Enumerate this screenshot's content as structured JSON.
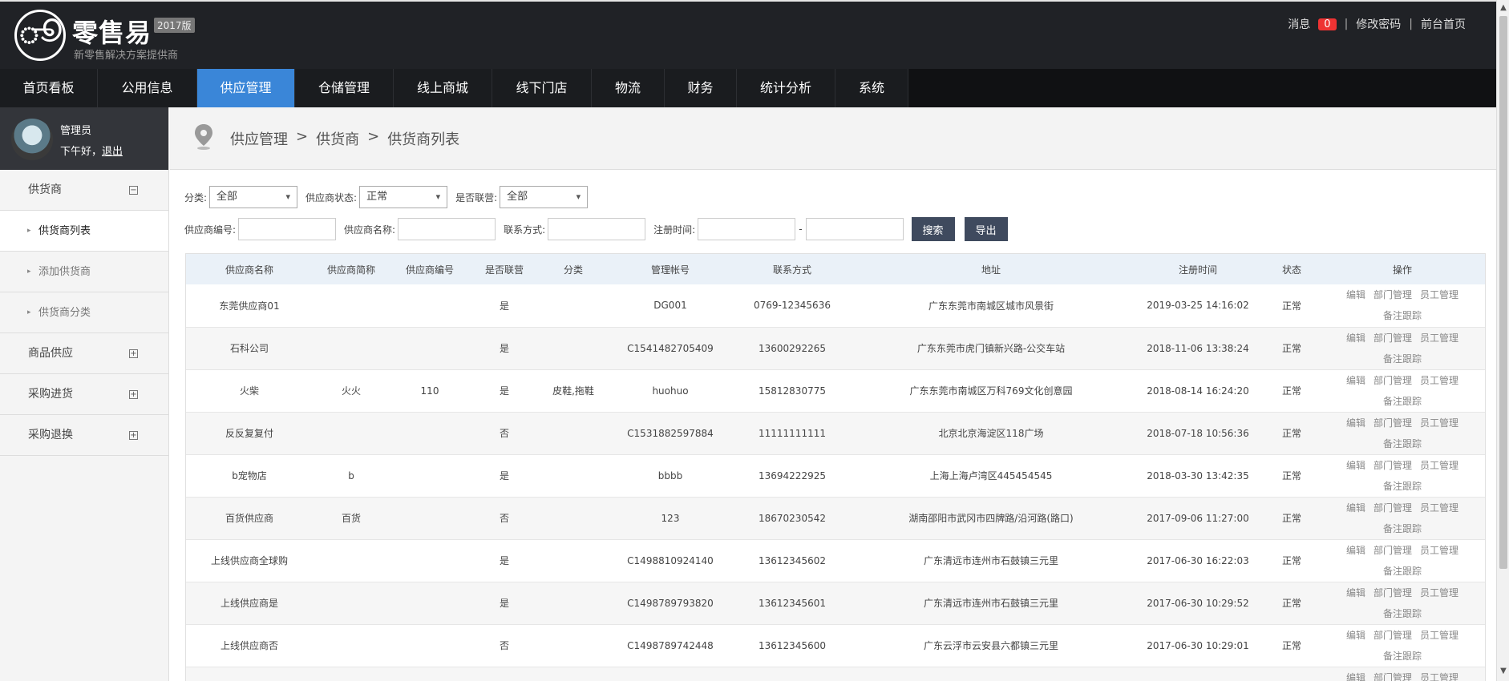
{
  "header": {
    "logo_glyph": "ூ",
    "brand": "零售易",
    "version": "2017版",
    "subtitle": "新零售解决方案提供商",
    "messages_label": "消息",
    "messages_count": "0",
    "change_password": "修改密码",
    "front_home": "前台首页"
  },
  "nav": [
    {
      "label": "首页看板"
    },
    {
      "label": "公用信息"
    },
    {
      "label": "供应管理"
    },
    {
      "label": "仓储管理"
    },
    {
      "label": "线上商城"
    },
    {
      "label": "线下门店"
    },
    {
      "label": "物流"
    },
    {
      "label": "财务"
    },
    {
      "label": "统计分析"
    },
    {
      "label": "系统"
    }
  ],
  "user": {
    "name": "管理员",
    "greeting": "下午好，",
    "logout": "退出"
  },
  "sidebar": {
    "group_supplier": "供货商",
    "collapse_sym": "−",
    "expand_sym": "+",
    "item_list": "供货商列表",
    "item_add": "添加供货商",
    "item_category": "供货商分类",
    "group_goods": "商品供应",
    "group_purchase": "采购进货",
    "group_return": "采购退换"
  },
  "breadcrumb": {
    "l1": "供应管理",
    "sep": ">",
    "l2": "供货商",
    "l3": "供货商列表"
  },
  "filters": {
    "category_label": "分类:",
    "category_value": "全部",
    "status_label": "供应商状态:",
    "status_value": "正常",
    "joint_label": "是否联营:",
    "joint_value": "全部",
    "code_label": "供应商编号:",
    "name_label": "供应商名称:",
    "contact_label": "联系方式:",
    "regtime_label": "注册时间:",
    "dash": "-",
    "search_btn": "搜索",
    "export_btn": "导出"
  },
  "table": {
    "headers": [
      "供应商名称",
      "供应商简称",
      "供应商编号",
      "是否联营",
      "分类",
      "管理帐号",
      "联系方式",
      "地址",
      "注册时间",
      "状态",
      "操作"
    ],
    "ops": {
      "edit": "编辑",
      "dept": "部门管理",
      "staff": "员工管理",
      "note": "备注跟踪"
    },
    "rows": [
      [
        "东莞供应商01",
        "",
        "",
        "是",
        "",
        "DG001",
        "0769-12345636",
        "广东东莞市南城区城市风景街",
        "2019-03-25 14:16:02",
        "正常"
      ],
      [
        "石科公司",
        "",
        "",
        "是",
        "",
        "C1541482705409",
        "13600292265",
        "广东东莞市虎门镇新兴路-公交车站",
        "2018-11-06 13:38:24",
        "正常"
      ],
      [
        "火柴",
        "火火",
        "110",
        "是",
        "皮鞋,拖鞋",
        "huohuo",
        "15812830775",
        "广东东莞市南城区万科769文化创意园",
        "2018-08-14 16:24:20",
        "正常"
      ],
      [
        "反反复复付",
        "",
        "",
        "否",
        "",
        "C1531882597884",
        "11111111111",
        "北京北京海淀区118广场",
        "2018-07-18 10:56:36",
        "正常"
      ],
      [
        "b宠物店",
        "b",
        "",
        "是",
        "",
        "bbbb",
        "13694222925",
        "上海上海卢湾区445454545",
        "2018-03-30 13:42:35",
        "正常"
      ],
      [
        "百货供应商",
        "百货",
        "",
        "否",
        "",
        "123",
        "18670230542",
        "湖南邵阳市武冈市四牌路/沿河路(路口)",
        "2017-09-06 11:27:00",
        "正常"
      ],
      [
        "上线供应商全球购",
        "",
        "",
        "是",
        "",
        "C1498810924140",
        "13612345602",
        "广东清远市连州市石鼓镇三元里",
        "2017-06-30 16:22:03",
        "正常"
      ],
      [
        "上线供应商是",
        "",
        "",
        "是",
        "",
        "C1498789793820",
        "13612345601",
        "广东清远市连州市石鼓镇三元里",
        "2017-06-30 10:29:52",
        "正常"
      ],
      [
        "上线供应商否",
        "",
        "",
        "否",
        "",
        "C1498789742448",
        "13612345600",
        "广东云浮市云安县六都镇三元里",
        "2017-06-30 10:29:01",
        "正常"
      ],
      [
        "",
        "",
        "",
        "",
        "",
        "",
        "",
        "",
        "",
        ""
      ]
    ]
  },
  "scrollbar": {
    "up": "▲",
    "down": "▼"
  },
  "colors": {
    "nav_active": "#3a86d8",
    "header_bg": "#202226",
    "badge": "#e33333"
  }
}
